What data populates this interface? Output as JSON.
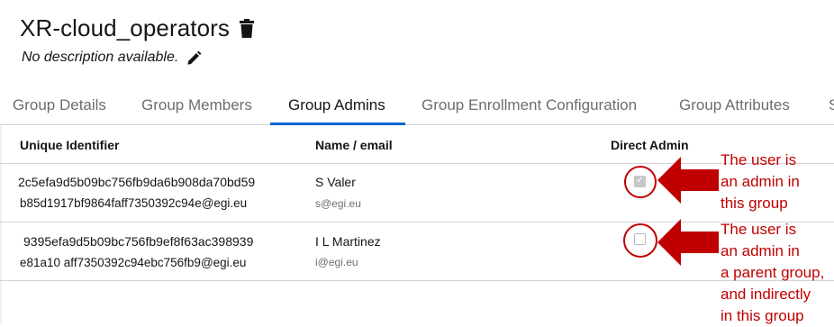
{
  "header": {
    "title": "XR-cloud_operators",
    "description": "No description available."
  },
  "tabs": [
    {
      "label": "Group Details",
      "active": false
    },
    {
      "label": "Group Members",
      "active": false
    },
    {
      "label": "Group Admins",
      "active": true
    },
    {
      "label": "Group Enrollment Configuration",
      "active": false
    },
    {
      "label": "Group Attributes",
      "active": false
    },
    {
      "label": "S",
      "active": false
    }
  ],
  "table": {
    "columns": [
      "Unique Identifier",
      "Name / email",
      "Direct Admin"
    ],
    "rows": [
      {
        "uid_line1": "2c5efa9d5b09bc756fb9da6b908da70bd59",
        "uid_line2": "b85d1917bf9864faff7350392c94e@egi.eu",
        "name": "S Valer",
        "email": "s@egi.eu",
        "direct_admin": true
      },
      {
        "uid_line1": "9395efa9d5b09bc756fb9ef8f63ac398939",
        "uid_line2": "e81a10 aff7350392c94ebc756fb9@egi.eu",
        "name": "I L Martinez",
        "email": "i@egi.eu",
        "direct_admin": false
      }
    ]
  },
  "annotations": {
    "first": [
      "The user is",
      "an admin in",
      "this group"
    ],
    "second": [
      "The user is",
      "an admin in",
      "a parent group,",
      "and indirectly",
      "in this group"
    ]
  },
  "colors": {
    "accent": "#0066cc",
    "annotation": "#c00000",
    "arrow": "#c00000"
  },
  "icons": [
    "trash-icon",
    "pencil-icon",
    "arrow-left-icon"
  ]
}
